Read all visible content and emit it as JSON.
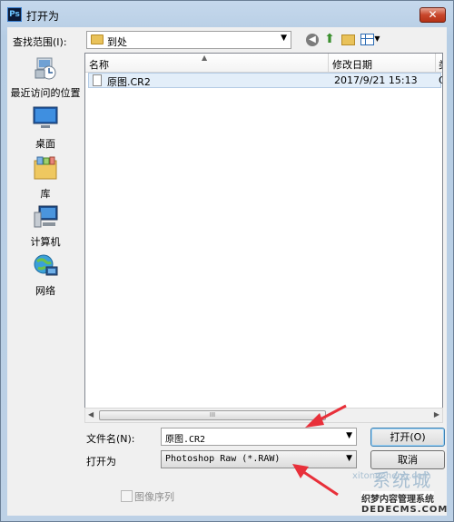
{
  "window": {
    "title": "打开为",
    "app_icon": "Ps",
    "close_label": "✕"
  },
  "lookin": {
    "label": "查找范围(I):",
    "value": "到处"
  },
  "places": [
    {
      "label": "最近访问的位置",
      "icon": "recent-places-icon"
    },
    {
      "label": "桌面",
      "icon": "desktop-icon"
    },
    {
      "label": "库",
      "icon": "libraries-icon"
    },
    {
      "label": "计算机",
      "icon": "computer-icon"
    },
    {
      "label": "网络",
      "icon": "network-icon"
    }
  ],
  "list": {
    "columns": [
      "名称",
      "修改日期",
      "类"
    ],
    "rows": [
      {
        "name": "原图.CR2",
        "date": "2017/9/21 15:13",
        "extra": "C"
      }
    ],
    "scroll_thumb": "III"
  },
  "filename": {
    "label": "文件名(N):",
    "value": "原图.CR2"
  },
  "filetype": {
    "label": "打开为",
    "value": "Photoshop Raw (*.RAW)"
  },
  "buttons": {
    "open": "打开(O)",
    "cancel": "取消"
  },
  "image_sequence": {
    "label": "图像序列",
    "checked": false
  },
  "watermark": {
    "big": "系统城",
    "pin": "xitongcheng.com",
    "line1": "织梦内容管理系统",
    "line2": "DEDECMS.COM"
  },
  "colors": {
    "annotation_arrow": "#e8303a",
    "selection": "#e3eef9"
  }
}
